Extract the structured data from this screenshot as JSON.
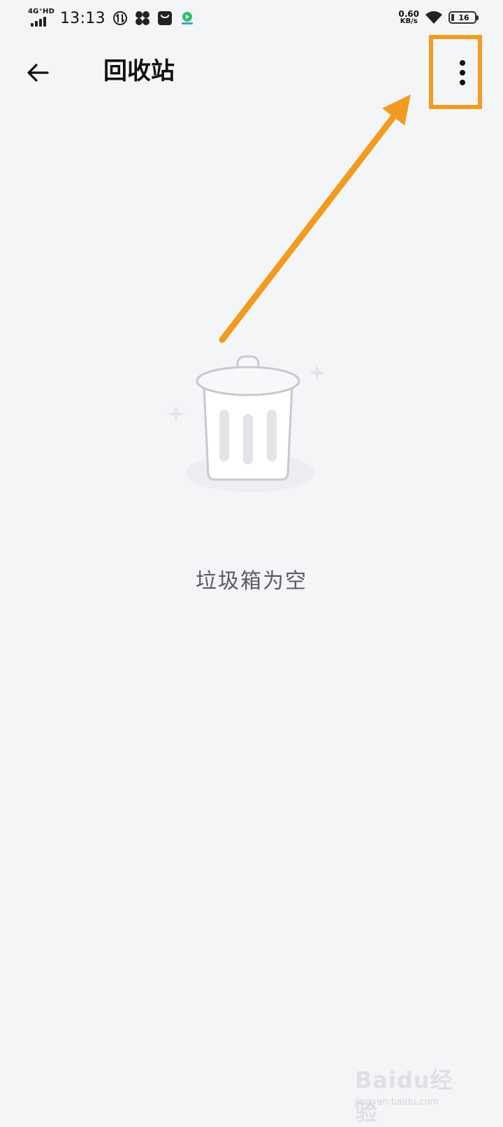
{
  "status_bar": {
    "network": "4G⁺HD",
    "time": "13:13",
    "net_speed_value": "0.60",
    "net_speed_unit": "KB/s",
    "battery": "16",
    "icons": [
      "data-saver-icon",
      "fan-icon",
      "shopping-bag-icon",
      "video-app-icon",
      "wifi-icon"
    ]
  },
  "app_bar": {
    "back_icon": "arrow-left-icon",
    "title": "回收站",
    "more_icon": "more-vertical-icon"
  },
  "empty_state": {
    "illustration": "trash-bin-icon",
    "message": "垃圾箱为空"
  },
  "annotation": {
    "highlight_color": "#f29b1f",
    "arrow_color": "#f29b1f"
  },
  "watermark": {
    "logo": "Baidu经验",
    "sub": "jingyan.baidu.com"
  }
}
